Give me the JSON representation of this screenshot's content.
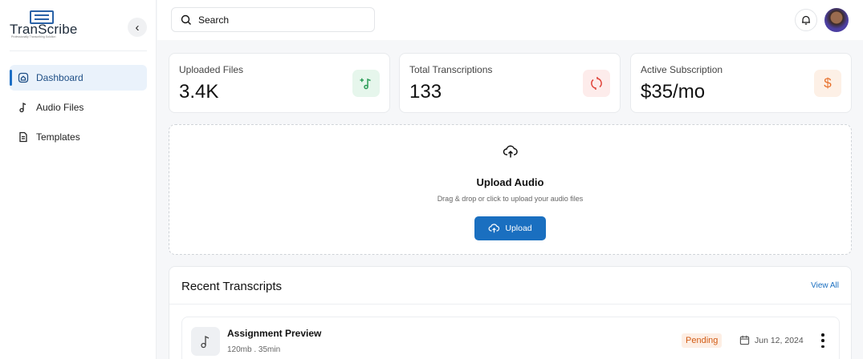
{
  "brand": {
    "name": "TranScribe",
    "tagline": "Professionally Transcribing Solution"
  },
  "sidebar": {
    "items": [
      {
        "label": "Dashboard",
        "icon": "home-icon",
        "active": true
      },
      {
        "label": "Audio Files",
        "icon": "music-note-icon",
        "active": false
      },
      {
        "label": "Templates",
        "icon": "document-icon",
        "active": false
      }
    ]
  },
  "header": {
    "search_placeholder": "Search"
  },
  "stats": [
    {
      "label": "Uploaded Files",
      "value": "3.4K",
      "icon": "music-add-icon",
      "icon_color": "#2e9e5a",
      "icon_bg": "#e6f6ec"
    },
    {
      "label": "Total Transcriptions",
      "value": "133",
      "icon": "refresh-icon",
      "icon_color": "#e0443a",
      "icon_bg": "#fdeceb"
    },
    {
      "label": "Active Subscription",
      "value": "$35/mo",
      "icon": "dollar-icon",
      "icon_color": "#e7702c",
      "icon_bg": "#fdf0e6"
    }
  ],
  "upload": {
    "title": "Upload Audio",
    "subtitle": "Drag & drop or click to upload your audio files",
    "button_label": "Upload"
  },
  "recent": {
    "title": "Recent Transcripts",
    "view_all": "View All",
    "rows": [
      {
        "name": "Assignment Preview",
        "meta": "120mb . 35min",
        "status": "Pending",
        "date": "Jun 12, 2024"
      }
    ]
  },
  "colors": {
    "primary": "#1a6fc0",
    "pending_text": "#d15b14",
    "pending_bg": "#fdeee4"
  }
}
